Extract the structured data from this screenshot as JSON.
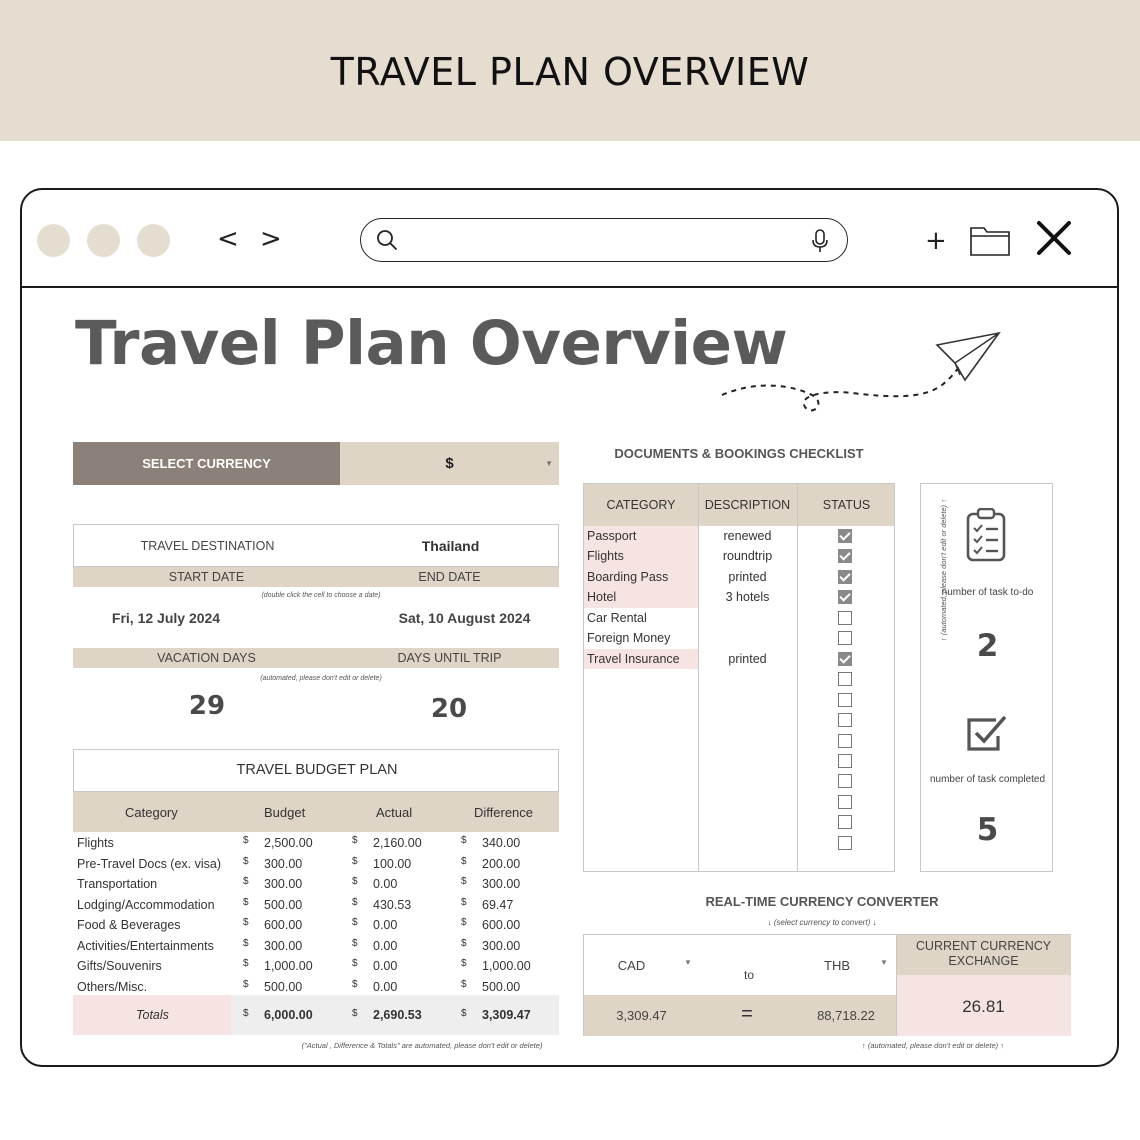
{
  "banner": {
    "title": "TRAVEL PLAN OVERVIEW"
  },
  "browser": {
    "back": "<",
    "forward": ">",
    "new_tab": "+"
  },
  "page": {
    "title": "Travel Plan Overview"
  },
  "currency": {
    "label": "SELECT CURRENCY",
    "value": "$"
  },
  "trip": {
    "destination_label": "TRAVEL DESTINATION",
    "destination": "Thailand",
    "start_label": "START DATE",
    "end_label": "END DATE",
    "date_hint": "(double click the cell to choose a date)",
    "start_date": "Fri, 12 July 2024",
    "end_date": "Sat, 10 August 2024",
    "vacation_label": "VACATION DAYS",
    "until_label": "DAYS UNTIL TRIP",
    "auto_hint": "(automated, please don't edit or delete)",
    "vacation_days": "29",
    "days_until": "20"
  },
  "budget": {
    "title": "TRAVEL BUDGET PLAN",
    "headers": [
      "Category",
      "Budget",
      "Actual",
      "Difference"
    ],
    "currency_symbol": "$",
    "rows": [
      {
        "category": "Flights",
        "budget": "2,500.00",
        "actual": "2,160.00",
        "difference": "340.00"
      },
      {
        "category": "Pre-Travel Docs (ex. visa)",
        "budget": "300.00",
        "actual": "100.00",
        "difference": "200.00"
      },
      {
        "category": "Transportation",
        "budget": "300.00",
        "actual": "0.00",
        "difference": "300.00"
      },
      {
        "category": "Lodging/Accommodation",
        "budget": "500.00",
        "actual": "430.53",
        "difference": "69.47"
      },
      {
        "category": "Food & Beverages",
        "budget": "600.00",
        "actual": "0.00",
        "difference": "600.00"
      },
      {
        "category": "Activities/Entertainments",
        "budget": "300.00",
        "actual": "0.00",
        "difference": "300.00"
      },
      {
        "category": "Gifts/Souvenirs",
        "budget": "1,000.00",
        "actual": "0.00",
        "difference": "1,000.00"
      },
      {
        "category": "Others/Misc.",
        "budget": "500.00",
        "actual": "0.00",
        "difference": "500.00"
      }
    ],
    "totals": {
      "label": "Totals",
      "budget": "6,000.00",
      "actual": "2,690.53",
      "difference": "3,309.47"
    },
    "note": "(\"Actual , Difference & Totals\" are automated, please don't edit or delete)"
  },
  "checklist": {
    "title": "DOCUMENTS & BOOKINGS CHECKLIST",
    "headers": [
      "CATEGORY",
      "DESCRIPTION",
      "STATUS"
    ],
    "rows": [
      {
        "category": "Passport",
        "description": "renewed",
        "done": true,
        "highlight": true
      },
      {
        "category": "Flights",
        "description": "roundtrip",
        "done": true,
        "highlight": true
      },
      {
        "category": "Boarding Pass",
        "description": "printed",
        "done": true,
        "highlight": true
      },
      {
        "category": "Hotel",
        "description": "3 hotels",
        "done": true,
        "highlight": true
      },
      {
        "category": "Car Rental",
        "description": "",
        "done": false,
        "highlight": false
      },
      {
        "category": "Foreign Money",
        "description": "",
        "done": false,
        "highlight": false
      },
      {
        "category": "Travel Insurance",
        "description": "printed",
        "done": true,
        "highlight": true
      },
      {
        "category": "",
        "description": "",
        "done": false,
        "highlight": false
      },
      {
        "category": "",
        "description": "",
        "done": false,
        "highlight": false
      },
      {
        "category": "",
        "description": "",
        "done": false,
        "highlight": false
      },
      {
        "category": "",
        "description": "",
        "done": false,
        "highlight": false
      },
      {
        "category": "",
        "description": "",
        "done": false,
        "highlight": false
      },
      {
        "category": "",
        "description": "",
        "done": false,
        "highlight": false
      },
      {
        "category": "",
        "description": "",
        "done": false,
        "highlight": false
      },
      {
        "category": "",
        "description": "",
        "done": false,
        "highlight": false
      },
      {
        "category": "",
        "description": "",
        "done": false,
        "highlight": false
      }
    ]
  },
  "tasks": {
    "todo_label": "number of task to-do",
    "todo_count": "2",
    "completed_label": "number of task completed",
    "completed_count": "5",
    "side_note": "↑ (automated, please don't edit or delete) ↑"
  },
  "converter": {
    "title": "REAL-TIME CURRENCY CONVERTER",
    "hint": "↓ (select currency to convert) ↓",
    "from_currency": "CAD",
    "to_word": "to",
    "to_currency": "THB",
    "rate_label": "CURRENT CURRENCY EXCHANGE",
    "from_amount": "3,309.47",
    "equals": "=",
    "to_amount": "88,718.22",
    "rate": "26.81",
    "note": "↑ (automated, please don't edit or delete) ↑"
  },
  "colors": {
    "banner": "#e6ddd1",
    "accent_dark": "#8c8178",
    "band": "#dfd5c7",
    "pink": "#f6e4e2",
    "title_gray": "#5a5a5a"
  }
}
